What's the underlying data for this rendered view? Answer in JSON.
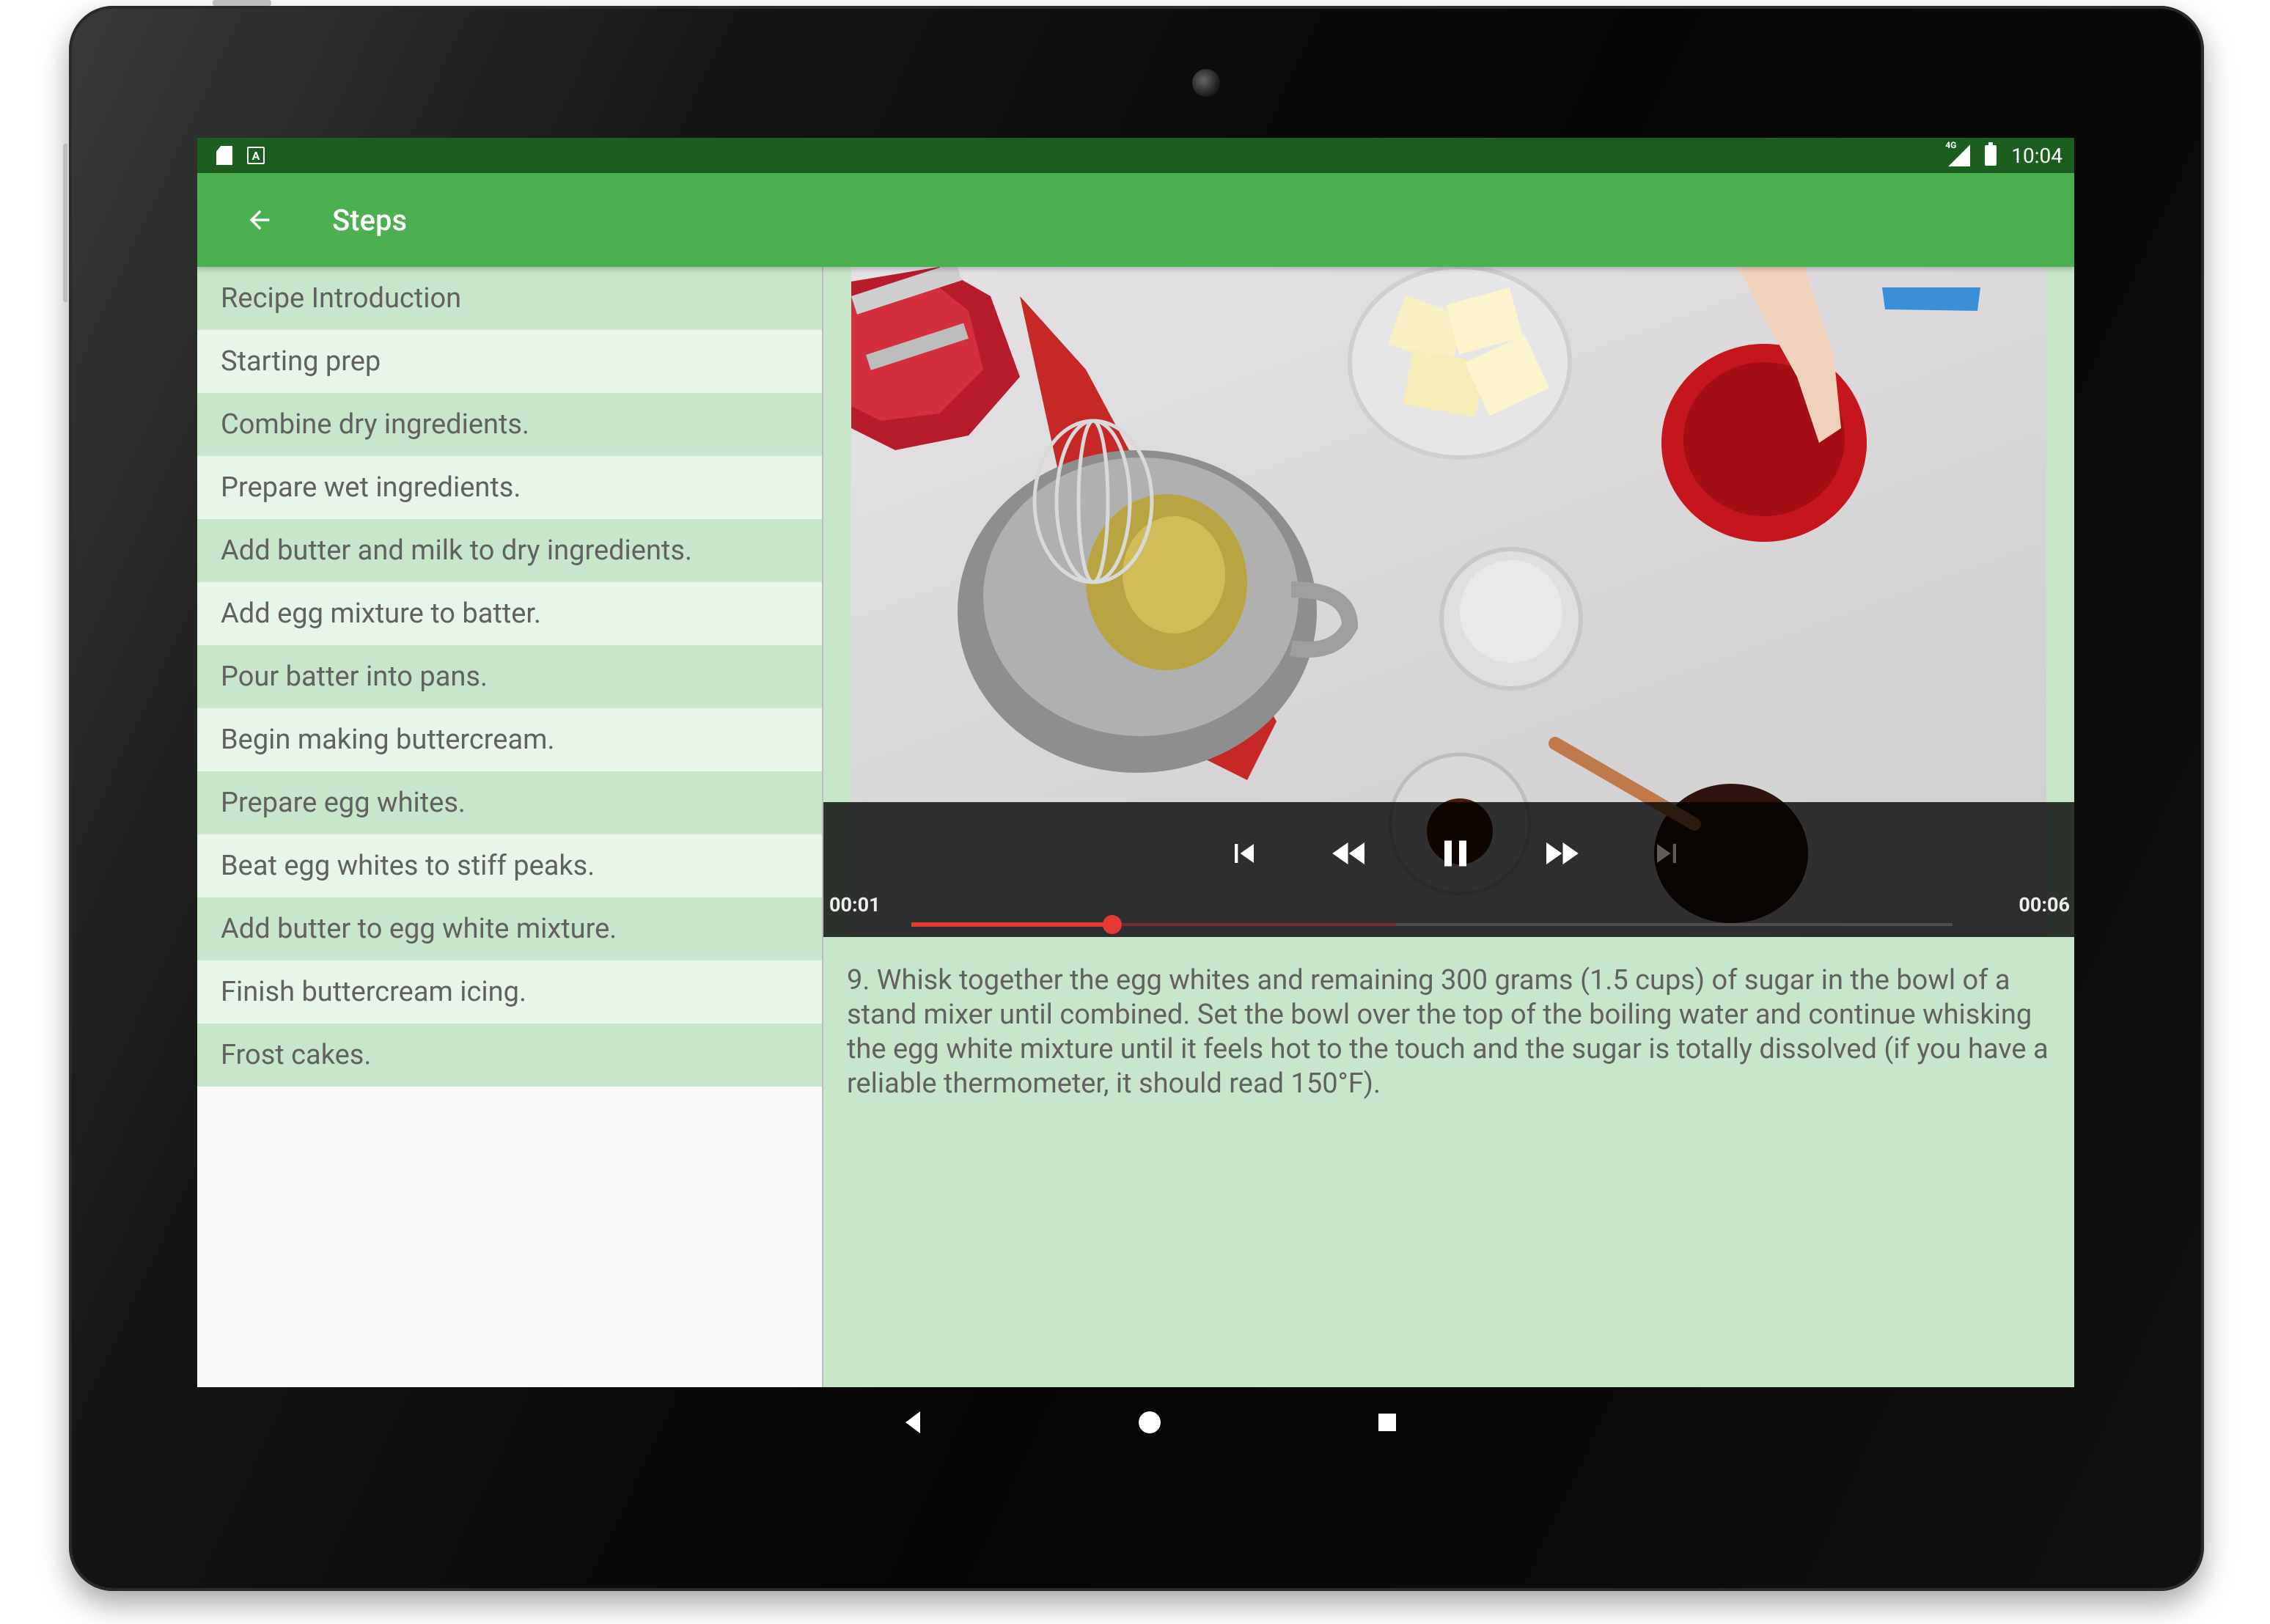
{
  "status_bar": {
    "left_icons": [
      "sd-card-icon",
      "a-notification-icon"
    ],
    "network_label": "4G",
    "time": "10:04"
  },
  "app_bar": {
    "back_icon": "arrow-left-icon",
    "title": "Steps"
  },
  "steps": [
    "Recipe Introduction",
    "Starting prep",
    "Combine dry ingredients.",
    "Prepare wet ingredients.",
    "Add butter and milk to dry ingredients.",
    "Add egg mixture to batter.",
    "Pour batter into pans.",
    "Begin making buttercream.",
    "Prepare egg whites.",
    "Beat egg whites to stiff peaks.",
    "Add butter to egg white mixture.",
    "Finish buttercream icing.",
    "Frost cakes."
  ],
  "player": {
    "controls": [
      "skip-previous-icon",
      "rewind-icon",
      "pause-icon",
      "fast-forward-icon",
      "skip-next-icon"
    ],
    "position": "00:01",
    "duration": "00:06",
    "played_fraction": 0.2,
    "buffered_fraction": 0.5
  },
  "instruction": "9. Whisk together the egg whites and remaining 300 grams (1.5 cups) of sugar in the bowl of a stand mixer until combined. Set the bowl over the top of the boiling water and continue whisking the egg white mixture until it feels hot to the touch and the sugar is totally dissolved (if you have a reliable thermometer, it should read 150°F).",
  "nav_bar": [
    "back-triangle-icon",
    "home-circle-icon",
    "recents-square-icon"
  ],
  "colors": {
    "status_bar": "#1b5e20",
    "app_bar": "#4caf50",
    "list_odd": "#c8e6c9",
    "list_even": "#e8f5e9",
    "seek_accent": "#e53935"
  }
}
